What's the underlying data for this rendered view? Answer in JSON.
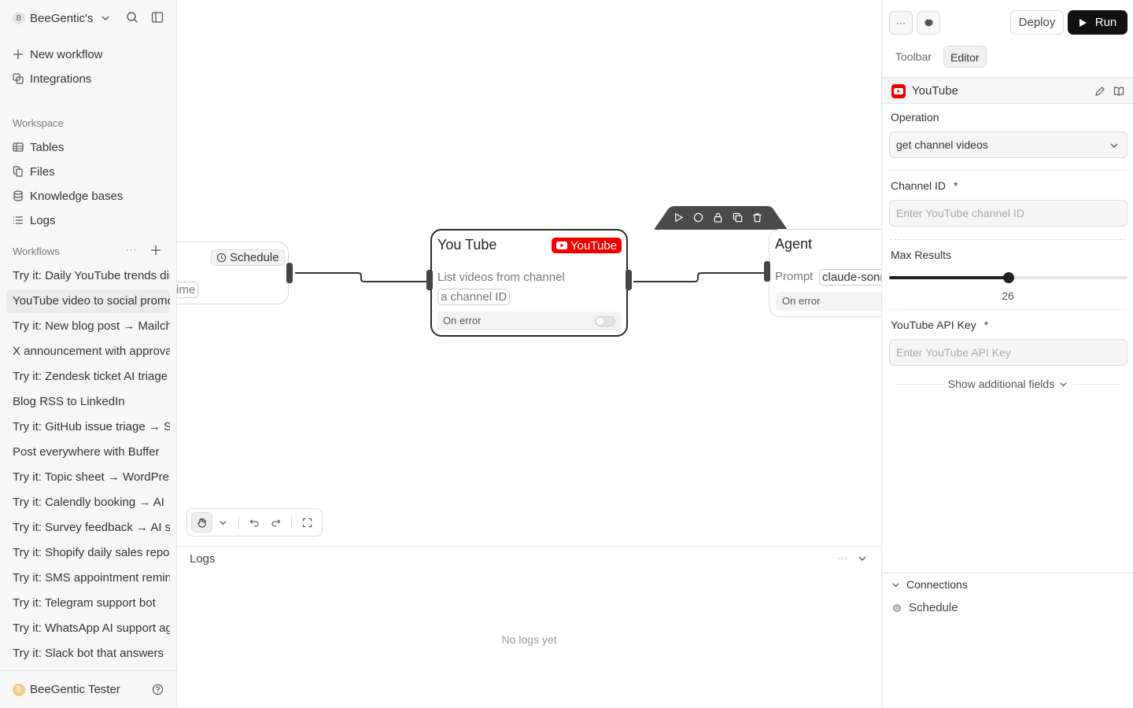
{
  "sidebar": {
    "workspace_initial": "B",
    "workspace_name": "BeeGentic's",
    "actions": [
      {
        "label": "New workflow"
      },
      {
        "label": "Integrations"
      }
    ],
    "workspace_label": "Workspace",
    "workspace_items": [
      {
        "label": "Tables"
      },
      {
        "label": "Files"
      },
      {
        "label": "Knowledge bases"
      },
      {
        "label": "Logs"
      }
    ],
    "workflows_label": "Workflows",
    "workflows": [
      {
        "label": "Try it: Daily YouTube trends digest"
      },
      {
        "label": "YouTube video to social promo"
      },
      {
        "label": "Try it: New blog post → Mailchimp"
      },
      {
        "label": "X announcement with approval"
      },
      {
        "label": "Try it: Zendesk ticket AI triage"
      },
      {
        "label": "Blog RSS to LinkedIn"
      },
      {
        "label": "Try it: GitHub issue triage → Slack"
      },
      {
        "label": "Post everywhere with Buffer"
      },
      {
        "label": "Try it: Topic sheet → WordPress"
      },
      {
        "label": "Try it: Calendly booking → AI"
      },
      {
        "label": "Try it: Survey feedback → AI summary"
      },
      {
        "label": "Try it: Shopify daily sales report"
      },
      {
        "label": "Try it: SMS appointment reminders"
      },
      {
        "label": "Try it: Telegram support bot"
      },
      {
        "label": "Try it: WhatsApp AI support agent"
      },
      {
        "label": "Try it: Slack bot that answers"
      }
    ],
    "user_initial": "B",
    "user_name": "BeeGentic Tester"
  },
  "canvas": {
    "schedule_node": {
      "tag": "Schedule",
      "token": "time"
    },
    "youtube_node": {
      "title": "You Tube",
      "badge": "YouTube",
      "subtitle": "List videos from channel",
      "token": "a channel ID",
      "on_error": "On error"
    },
    "agent_node": {
      "title": "Agent",
      "prompt_label": "Prompt",
      "model_token": "claude-sonnet",
      "on_error": "On error"
    }
  },
  "logs": {
    "title": "Logs",
    "empty_text": "No logs yet"
  },
  "panel": {
    "more_label": "···",
    "deploy_label": "Deploy",
    "run_label": "Run",
    "tabs": [
      {
        "label": "Toolbar"
      },
      {
        "label": "Editor"
      }
    ],
    "block_name": "YouTube",
    "operation_label": "Operation",
    "operation_value": "get channel videos",
    "channel_label": "Channel ID",
    "channel_placeholder": "Enter YouTube channel ID",
    "max_results_label": "Max Results",
    "max_results_value": "26",
    "max_results_fraction": 0.5,
    "api_key_label": "YouTube API Key",
    "api_key_placeholder": "Enter YouTube API Key",
    "required_mark": "*",
    "show_more_label": "Show additional fields",
    "connections_label": "Connections",
    "connections": [
      {
        "label": "Schedule"
      }
    ]
  },
  "colors": {
    "youtube_red": "#ee0000",
    "run_button": "#111111"
  }
}
